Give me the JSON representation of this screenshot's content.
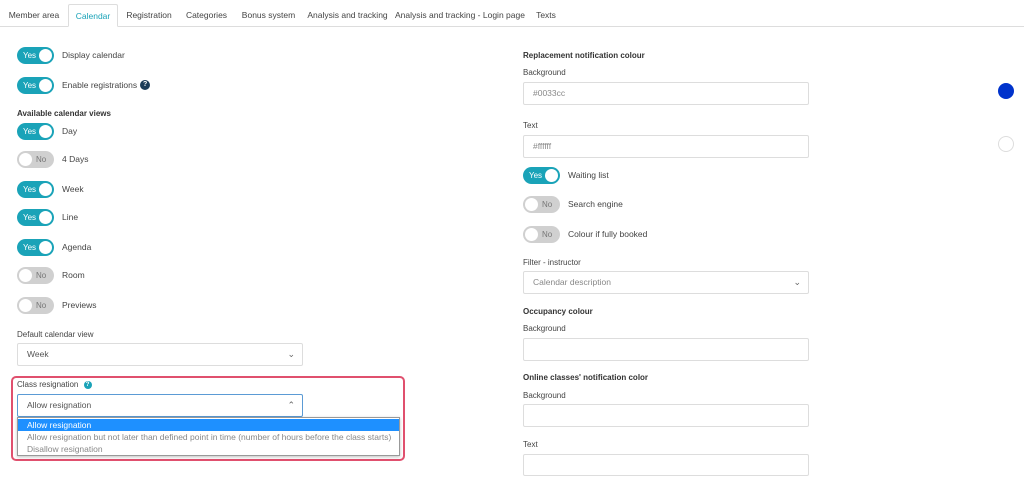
{
  "tabs": [
    {
      "label": "Member area"
    },
    {
      "label": "Calendar",
      "active": true
    },
    {
      "label": "Registration"
    },
    {
      "label": "Categories"
    },
    {
      "label": "Bonus system"
    },
    {
      "label": "Analysis and tracking"
    },
    {
      "label": "Analysis and tracking - Login page"
    },
    {
      "label": "Texts"
    }
  ],
  "toggle_text": {
    "on": "Yes",
    "off": "No"
  },
  "left": {
    "display_calendar": {
      "label": "Display calendar",
      "on": true
    },
    "enable_registrations": {
      "label": "Enable registrations",
      "on": true,
      "help": "?"
    },
    "views_heading": "Available calendar views",
    "views": [
      {
        "label": "Day",
        "on": true
      },
      {
        "label": "4 Days",
        "on": false
      },
      {
        "label": "Week",
        "on": true
      },
      {
        "label": "Line",
        "on": true
      },
      {
        "label": "Agenda",
        "on": true
      },
      {
        "label": "Room",
        "on": false
      },
      {
        "label": "Previews",
        "on": false
      }
    ],
    "default_view": {
      "label": "Default calendar view",
      "value": "Week"
    },
    "class_resignation": {
      "label": "Class resignation",
      "help": "?",
      "value": "Allow resignation",
      "options": [
        {
          "label": "Allow resignation",
          "selected": true
        },
        {
          "label": "Allow resignation but not later than defined point in time (number of hours before the class starts)",
          "selected": false
        },
        {
          "label": "Disallow resignation",
          "selected": false
        }
      ]
    }
  },
  "right": {
    "replacement_heading": "Replacement notification colour",
    "background_label": "Background",
    "background_value": "#0033cc",
    "text_label": "Text",
    "text_value": "#ffffff",
    "waiting_list": {
      "label": "Waiting list",
      "on": true
    },
    "search_engine": {
      "label": "Search engine",
      "on": false
    },
    "colour_if_full": {
      "label": "Colour if fully booked",
      "on": false
    },
    "filter_label": "Filter - instructor",
    "filter_value": "Calendar description",
    "occupancy_heading": "Occupancy colour",
    "occupancy_background_label": "Background",
    "online_heading": "Online classes' notification color",
    "online_background_label": "Background",
    "online_text_label": "Text"
  },
  "colors": {
    "accent": "#1aa3b8",
    "replacement_background": "#0033cc",
    "replacement_text": "#ffffff",
    "highlight_border": "#e0506e"
  }
}
